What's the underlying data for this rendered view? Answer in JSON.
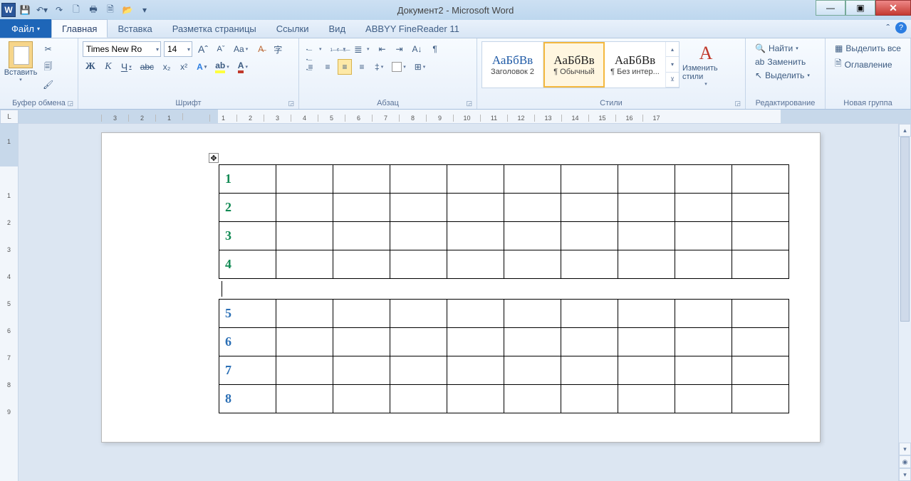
{
  "title": "Документ2 - Microsoft Word",
  "qat": {
    "app": "W"
  },
  "tabs": {
    "file": "Файл",
    "home": "Главная",
    "insert": "Вставка",
    "layout": "Разметка страницы",
    "refs": "Ссылки",
    "view": "Вид",
    "abbyy": "ABBYY FineReader 11"
  },
  "clipboard": {
    "paste": "Вставить",
    "group": "Буфер обмена"
  },
  "font": {
    "name": "Times New Ro",
    "size": "14",
    "bold": "Ж",
    "italic": "К",
    "underline": "Ч",
    "strike": "abc",
    "sub": "x₂",
    "sup": "x²",
    "aa": "Aa",
    "bigA": "A",
    "smallA": "A",
    "group": "Шрифт"
  },
  "para": {
    "group": "Абзац"
  },
  "styles": {
    "s1": {
      "prev": "АаБбВв",
      "name": "Заголовок 2"
    },
    "s2": {
      "prev": "АаБбВв",
      "name": "¶ Обычный"
    },
    "s3": {
      "prev": "АаБбВв",
      "name": "¶ Без интер..."
    },
    "change": "Изменить стили",
    "group": "Стили"
  },
  "editing": {
    "find": "Найти",
    "replace": "Заменить",
    "select": "Выделить",
    "group": "Редактирование"
  },
  "newgroup": {
    "selectall": "Выделить все",
    "toc": "Оглавление",
    "group": "Новая группа"
  },
  "ruler": {
    "h": [
      "3",
      "2",
      "1",
      "",
      "1",
      "2",
      "3",
      "4",
      "5",
      "6",
      "7",
      "8",
      "9",
      "10",
      "11",
      "12",
      "13",
      "14",
      "15",
      "16",
      "17"
    ],
    "v": [
      "1",
      "",
      "1",
      "2",
      "3",
      "4",
      "5",
      "6",
      "7",
      "8",
      "9"
    ]
  },
  "doc": {
    "table1": {
      "rows": [
        "1",
        "2",
        "3",
        "4"
      ],
      "cols": 10
    },
    "table2": {
      "rows": [
        "5",
        "6",
        "7",
        "8"
      ],
      "cols": 10
    }
  }
}
